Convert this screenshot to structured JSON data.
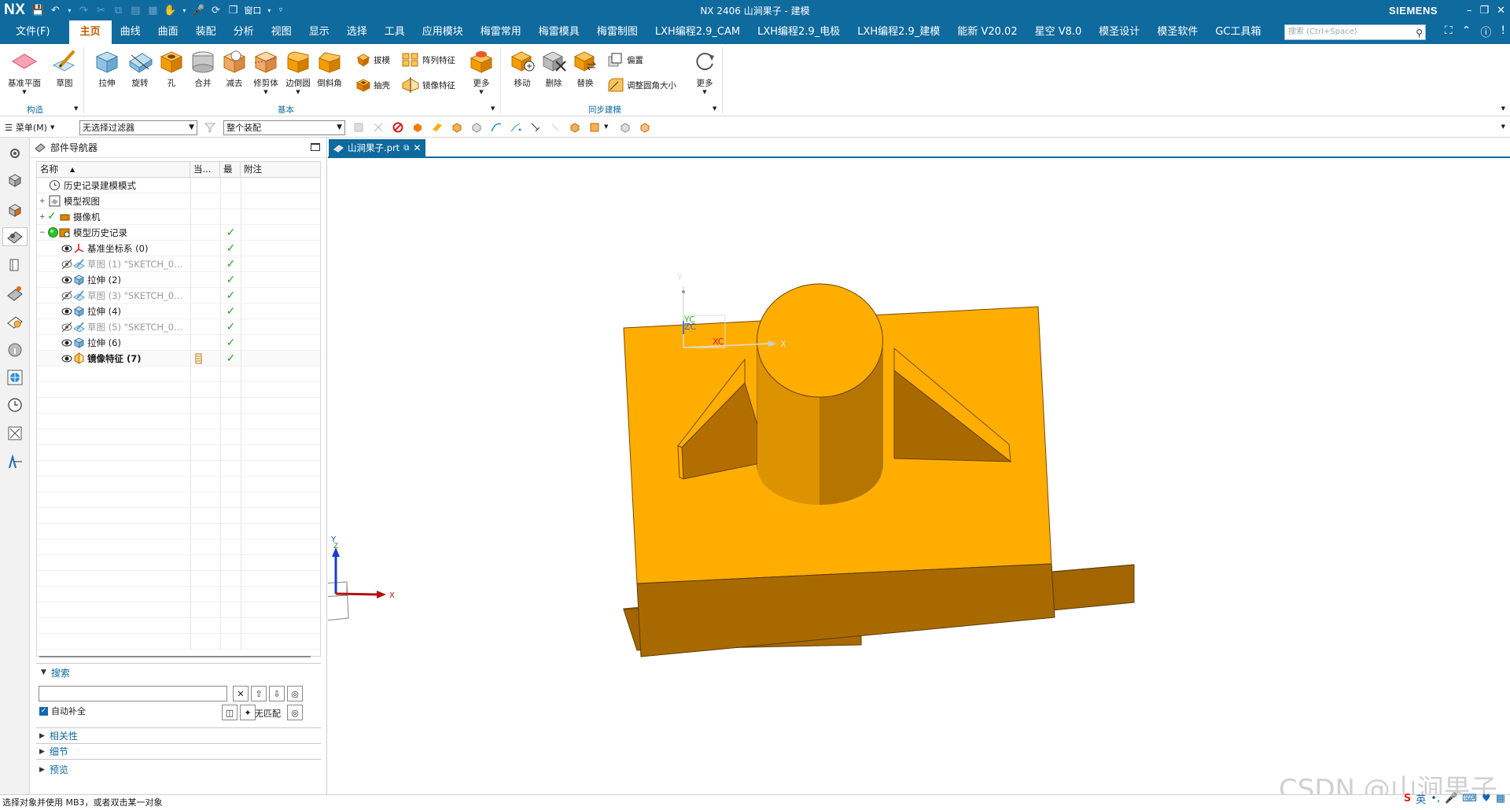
{
  "app": {
    "logo": "NX",
    "title": "NX 2406 山涧果子 - 建模",
    "brand": "SIEMENS",
    "window_menu_label": "窗口"
  },
  "menubar": {
    "items": [
      "文件(F)",
      "主页",
      "曲线",
      "曲面",
      "装配",
      "分析",
      "视图",
      "显示",
      "选择",
      "工具",
      "应用模块",
      "梅雷常用",
      "梅雷模具",
      "梅雷制图",
      "LXH编程2.9_CAM",
      "LXH编程2.9_电极",
      "LXH编程2.9_建模",
      "能新 V20.02",
      "星空 V8.0",
      "模圣设计",
      "模圣软件",
      "GC工具箱"
    ],
    "active_index": 1,
    "search_placeholder": "搜索 (Ctrl+Space)"
  },
  "ribbon": {
    "construct": {
      "datum_plane": "基准平面",
      "sketch": "草图",
      "group": "构造"
    },
    "basic": {
      "extrude": "拉伸",
      "revolve": "旋转",
      "hole": "孔",
      "unite": "合并",
      "subtract": "减去",
      "trim_body": "修剪体",
      "edge_blend": "边倒圆",
      "chamfer": "倒斜角",
      "draft": "拔模",
      "shell": "抽壳",
      "pattern_feature": "阵列特征",
      "mirror_feature": "镜像特征",
      "more": "更多",
      "group": "基本"
    },
    "sync": {
      "move": "移动",
      "delete": "删除",
      "replace": "替换",
      "offset": "偏置",
      "resize_blend": "调整圆角大小",
      "more": "更多",
      "group": "同步建模"
    }
  },
  "toolbar2": {
    "menu_label": "菜单(M)",
    "filter": "无选择过滤器",
    "scope": "整个装配"
  },
  "navigator": {
    "title": "部件导航器",
    "columns": [
      "名称",
      "当...",
      "最",
      "附注"
    ],
    "rows": [
      {
        "text": "历史记录建模模式",
        "style": "normal"
      },
      {
        "text": "模型视图",
        "style": "normal"
      },
      {
        "text": "摄像机",
        "style": "normal"
      },
      {
        "text": "模型历史记录",
        "style": "normal"
      },
      {
        "text": "基准坐标系 (0)",
        "style": "normal"
      },
      {
        "text": "草图 (1) \"SKETCH_0...",
        "style": "grey"
      },
      {
        "text": "拉伸 (2)",
        "style": "normal"
      },
      {
        "text": "草图 (3) \"SKETCH_0...",
        "style": "grey"
      },
      {
        "text": "拉伸 (4)",
        "style": "normal"
      },
      {
        "text": "草图 (5) \"SKETCH_0...",
        "style": "grey"
      },
      {
        "text": "拉伸 (6)",
        "style": "normal"
      },
      {
        "text": "镜像特征 (7)",
        "style": "bold"
      }
    ],
    "search": {
      "title": "搜索",
      "auto_complete": "自动补全",
      "no_match": "无匹配"
    },
    "sections": [
      "相关性",
      "细节",
      "预览"
    ]
  },
  "viewport": {
    "tab_label": "山涧果子.prt",
    "wcs": {
      "x": "X",
      "y": "Y",
      "xc": "XC",
      "yc": "YC",
      "zc": "ZC"
    },
    "triad": {
      "x": "X",
      "y": "Y",
      "z": "Z"
    }
  },
  "status": {
    "prompt": "选择对象并使用 MB3，或者双击某一对象",
    "watermark": "CSDN @山涧果子",
    "ime": "英"
  },
  "colors": {
    "accent": "#0f6a9e",
    "part_top": "#ffae00",
    "part_side": "#a86a00",
    "check": "#2aa02a"
  }
}
